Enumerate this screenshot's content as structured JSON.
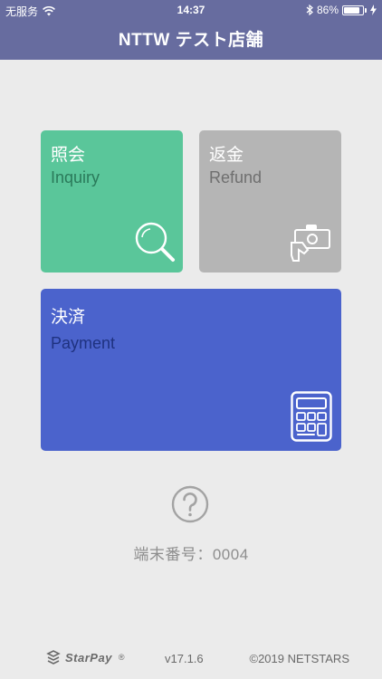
{
  "status_bar": {
    "carrier": "无服务",
    "time": "14:37",
    "battery_percent": "86%",
    "battery_level": 0.86
  },
  "header": {
    "title": "NTTW テスト店舗",
    "color": "#676c9f"
  },
  "tiles": {
    "inquiry": {
      "jp": "照会",
      "en": "Inquiry",
      "icon": "magnifier-icon",
      "color": "#5ac69a"
    },
    "refund": {
      "jp": "返金",
      "en": "Refund",
      "icon": "cash-hand-icon",
      "color": "#b5b5b5"
    },
    "payment": {
      "jp": "決済",
      "en": "Payment",
      "icon": "calculator-icon",
      "color": "#4b63cc"
    }
  },
  "help": {
    "icon": "question-circle-icon"
  },
  "terminal": {
    "label": "端末番号：",
    "number": "0004"
  },
  "footer": {
    "logo_text": "StarPay",
    "registered": "®",
    "version": "v17.1.6",
    "copyright": "©2019 NETSTARS"
  }
}
